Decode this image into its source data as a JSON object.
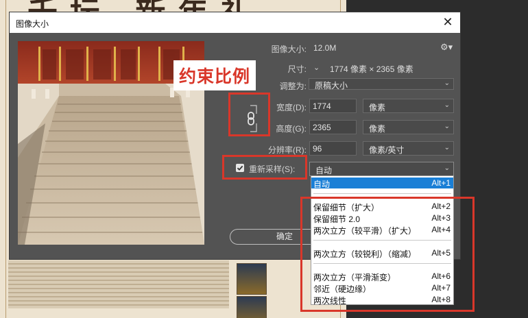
{
  "background": {
    "doc_title": "千坛 新年礼"
  },
  "dialog": {
    "title": "图像大小",
    "close_glyph": "✕",
    "image_size_label": "图像大小:",
    "image_size_value": "12.0M",
    "settings_icon": "gear-icon",
    "dimensions_label": "尺寸:",
    "dimensions_value": "1774 像素 × 2365 像素",
    "fit_to_label": "调整为:",
    "fit_to_value": "原稿大小",
    "width_label": "宽度(D):",
    "width_value": "1774",
    "width_unit": "像素",
    "height_label": "高度(G):",
    "height_value": "2365",
    "height_unit": "像素",
    "resolution_label": "分辨率(R):",
    "resolution_value": "96",
    "resolution_unit": "像素/英寸",
    "resample_label": "重新采样(S):",
    "resample_checked": true,
    "resample_value": "自动",
    "ok_label": "确定"
  },
  "annotation": {
    "constrain_tag": "约束比例",
    "highlight_color": "#d9372a"
  },
  "resample_menu": {
    "items": [
      {
        "label": "自动",
        "shortcut": "Alt+1",
        "selected": true
      },
      {
        "label": "保留细节（扩大）",
        "shortcut": "Alt+2"
      },
      {
        "label": "保留细节 2.0",
        "shortcut": "Alt+3"
      },
      {
        "label": "两次立方（较平滑）（扩大）",
        "shortcut": "Alt+4"
      },
      {
        "label": "两次立方（较锐利）（缩减）",
        "shortcut": "Alt+5"
      },
      {
        "label": "两次立方（平滑渐变）",
        "shortcut": "Alt+6"
      },
      {
        "label": "邻近（硬边缘）",
        "shortcut": "Alt+7"
      },
      {
        "label": "两次线性",
        "shortcut": "Alt+8"
      }
    ]
  },
  "colors": {
    "dialog_bg": "#535353",
    "menu_selected": "#1a7fd6"
  }
}
